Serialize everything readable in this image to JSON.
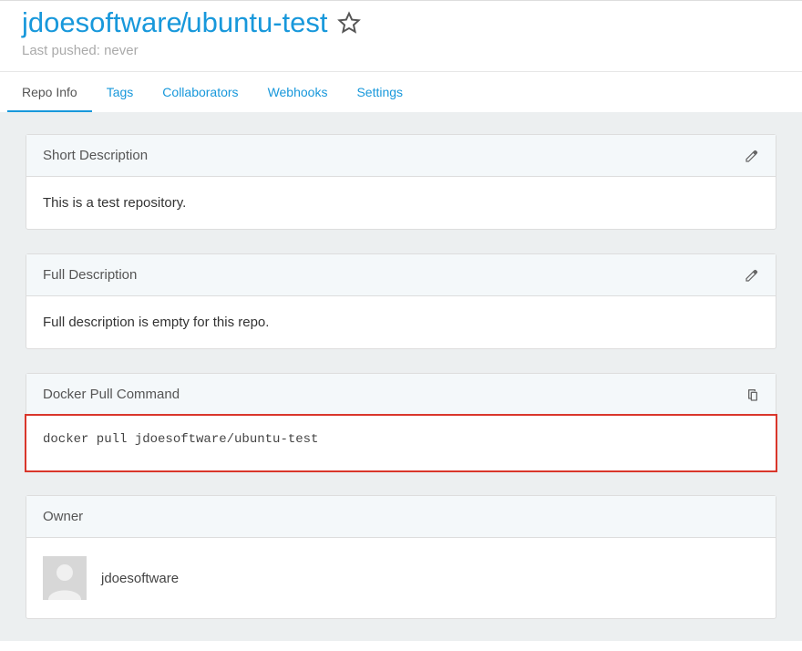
{
  "header": {
    "namespace": "jdoesoftware",
    "repo": "ubuntu-test",
    "last_pushed_label": "Last pushed: never"
  },
  "tabs": {
    "repo_info": "Repo Info",
    "tags": "Tags",
    "collaborators": "Collaborators",
    "webhooks": "Webhooks",
    "settings": "Settings"
  },
  "panels": {
    "short_desc": {
      "title": "Short Description",
      "body": "This is a test repository."
    },
    "full_desc": {
      "title": "Full Description",
      "body": "Full description is empty for this repo."
    },
    "pull_cmd": {
      "title": "Docker Pull Command",
      "command": "docker pull jdoesoftware/ubuntu-test"
    },
    "owner": {
      "title": "Owner",
      "name": "jdoesoftware"
    }
  }
}
